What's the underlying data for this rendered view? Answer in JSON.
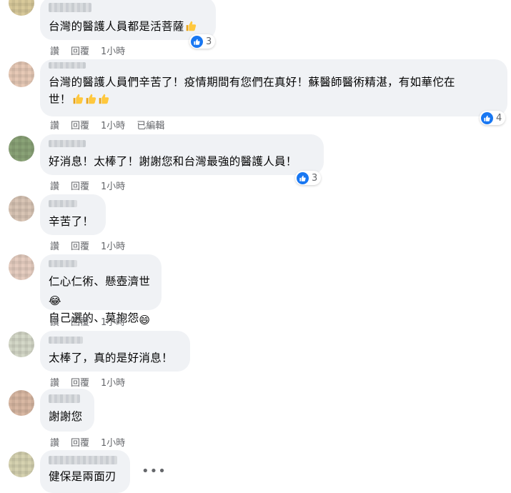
{
  "actions": {
    "like": "讚",
    "reply": "回覆"
  },
  "comments": [
    {
      "text": "台灣的醫護人員都是活菩薩",
      "time": "1小時",
      "reactions": "3"
    },
    {
      "name_partial": "陳王忠",
      "text_line1": "台灣的醫護人員們辛苦了！疫情期間有您們在真好！蘇醫師醫術精湛，有如華佗在",
      "text_line2": "世！",
      "time": "1小時",
      "edited": "已編輯",
      "reactions": "4"
    },
    {
      "text": "好消息！太棒了！謝謝您和台灣最強的醫護人員！",
      "time": "1小時",
      "reactions": "3"
    },
    {
      "text": "辛苦了！",
      "time": "1小時"
    },
    {
      "text_line1": "仁心仁術、懸壺濟世",
      "text_line2": "自己選的、莫抱怨",
      "time": "1小時"
    },
    {
      "text": "太棒了，真的是好消息！",
      "time": "1小時"
    },
    {
      "text": "謝謝您",
      "time": "1小時"
    },
    {
      "text": "健保是兩面刃"
    }
  ],
  "icons": {
    "like": "like-icon",
    "thumbs_up": "thumbs-up-emoji",
    "laughing": "laughing-emoji",
    "grinning": "grinning-emoji",
    "more": "more-options-icon"
  },
  "colors": {
    "bubble": "#f0f2f5",
    "like_blue": "#1877f2",
    "meta_gray": "#65676b"
  }
}
